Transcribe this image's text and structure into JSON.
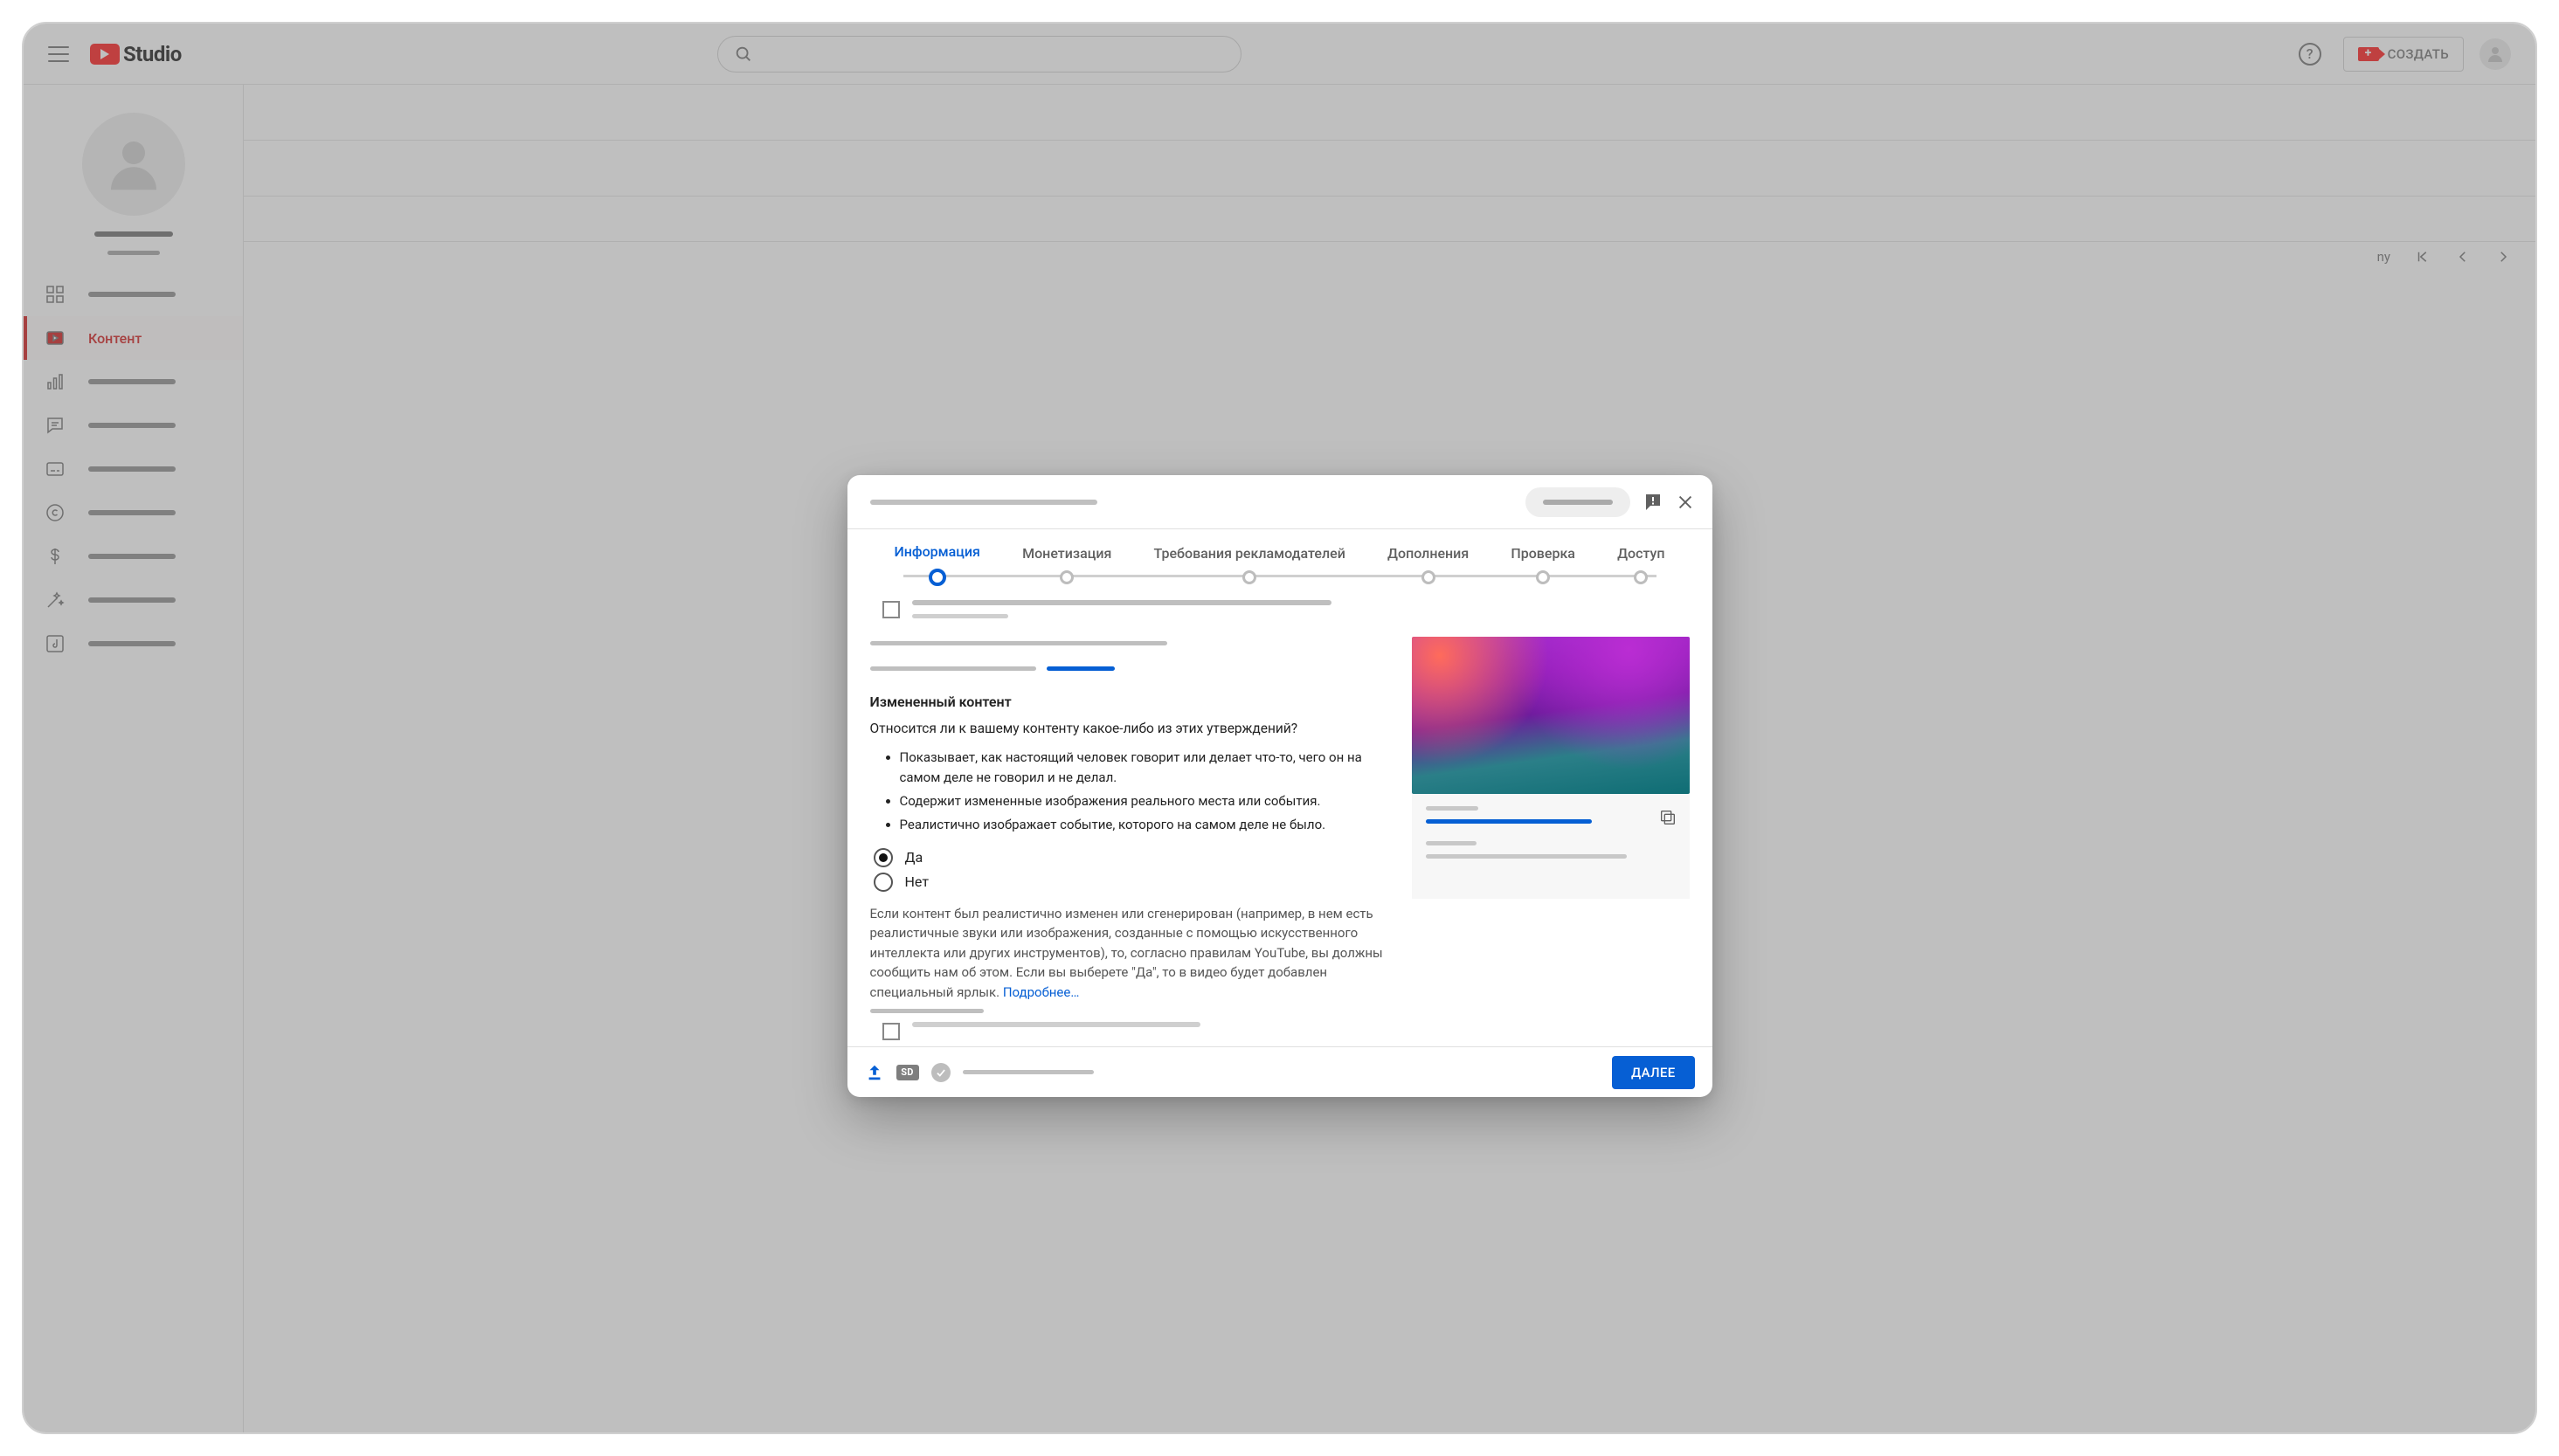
{
  "header": {
    "logo_text": "Studio",
    "create_label": "СОЗДАТЬ"
  },
  "sidebar": {
    "active_label": "Контент"
  },
  "pager": {
    "suffix": "ny"
  },
  "dialog": {
    "steps": [
      "Информация",
      "Монетизация",
      "Требования рекламодателей",
      "Дополнения",
      "Проверка",
      "Доступ"
    ],
    "active_step_index": 0,
    "altered": {
      "title": "Измененный контент",
      "question": "Относится ли к вашему контенту какое-либо из этих утверждений?",
      "bullets": [
        "Показывает, как настоящий человек говорит или делает что-то, чего он на самом деле не говорил и не делал.",
        "Содержит измененные изображения реального места или события.",
        "Реалистично изображает событие, которого на самом деле не было."
      ],
      "options": {
        "yes": "Да",
        "no": "Нет"
      },
      "selected": "yes",
      "explain": "Если контент был реалистично изменен или сгенерирован (например, в нем есть реалистичные звуки или изображения, созданные с помощью искусственного интеллекта или других инструментов), то, согласно правилам YouTube, вы должны сообщить нам об этом. Если вы выберете \"Да\", то в видео будет добавлен специальный ярлык. ",
      "learn_more": "Подробнее…"
    },
    "footer": {
      "sd_label": "SD",
      "next_label": "ДАЛЕЕ"
    }
  }
}
